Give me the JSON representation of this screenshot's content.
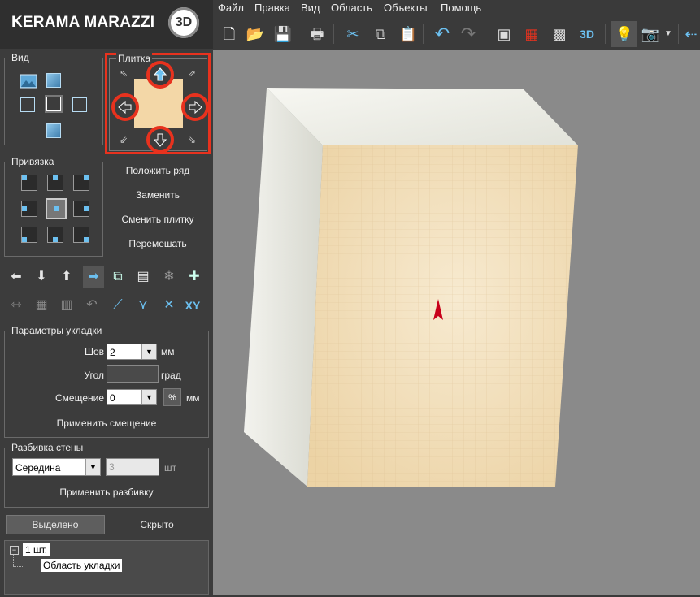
{
  "app": {
    "logo_text": "KERAMA MARAZZI",
    "logo_badge": "3D"
  },
  "menu": [
    "Файл",
    "Правка",
    "Вид",
    "Область",
    "Объекты",
    "Помощь"
  ],
  "toolbar": {
    "three_d_label": "3D"
  },
  "view_group": {
    "legend": "Вид"
  },
  "tile_group": {
    "legend": "Плитка"
  },
  "snap_group": {
    "legend": "Привязка"
  },
  "actions": {
    "lay_row": "Положить ряд",
    "replace": "Заменить",
    "change_tile": "Сменить плитку",
    "shuffle": "Перемешать"
  },
  "tools": {
    "xy_label": "XY"
  },
  "layout_params": {
    "legend": "Параметры укладки",
    "seam_label": "Шов",
    "seam_value": "2",
    "seam_unit": "мм",
    "angle_label": "Угол",
    "angle_value": "",
    "angle_unit": "град",
    "offset_label": "Смещение",
    "offset_value": "0",
    "offset_percent": "%",
    "offset_unit": "мм",
    "apply_offset": "Применить смещение"
  },
  "wall_split": {
    "legend": "Разбивка стены",
    "mode_value": "Середина",
    "count_value": "3",
    "count_unit": "шт",
    "apply_split": "Применить разбивку"
  },
  "tabs": {
    "selected": "Выделено",
    "hidden": "Скрыто"
  },
  "tree": {
    "root_label": "1 шт.",
    "child_label": "Область укладки",
    "expand_sign": "−"
  },
  "colors": {
    "highlight": "#e8321e",
    "tile": "#f3d7a7",
    "accent": "#6cc0f0"
  }
}
